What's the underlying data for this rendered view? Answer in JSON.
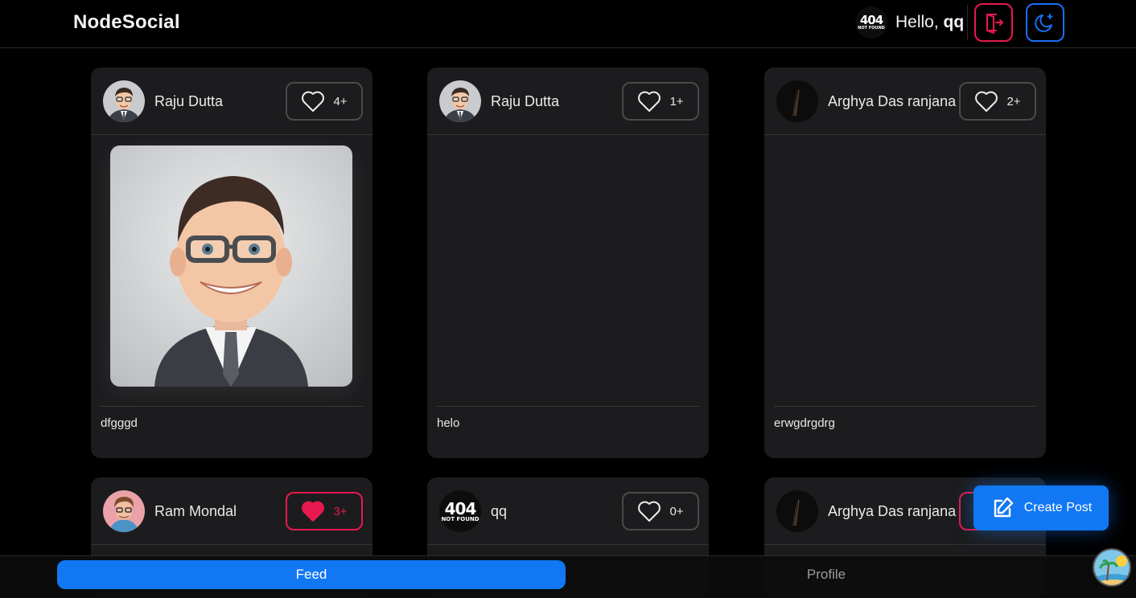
{
  "header": {
    "brand": "NodeSocial",
    "greeting": "Hello,",
    "username": "qq",
    "avatar_badge": {
      "line1": "404",
      "line2": "NOT FOUND"
    }
  },
  "posts": [
    {
      "author": "Raju Dutta",
      "likes": "4+",
      "liked": false,
      "caption": "dfgggd",
      "has_image": true
    },
    {
      "author": "Raju Dutta",
      "likes": "1+",
      "liked": false,
      "caption": "helo",
      "has_image": false
    },
    {
      "author": "Arghya Das ranjana",
      "likes": "2+",
      "liked": false,
      "caption": "erwgdrgdrg",
      "has_image": false
    },
    {
      "author": "Ram Mondal",
      "likes": "3+",
      "liked": true
    },
    {
      "author": "qq",
      "likes": "0+",
      "liked": false
    },
    {
      "author": "Arghya Das ranjana"
    }
  ],
  "fab": {
    "label": "Create Post"
  },
  "nav": {
    "feed": "Feed",
    "profile": "Profile"
  },
  "colors": {
    "accent": "#1277f2",
    "like": "#e8194f",
    "card": "#1c1c1e",
    "background": "#000000"
  }
}
